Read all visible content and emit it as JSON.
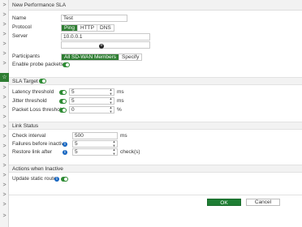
{
  "left_nav": {
    "chevrons": [
      ">",
      ">",
      ">",
      ">",
      ">",
      ">",
      ">",
      ">",
      ">",
      ">",
      ">",
      ">",
      ">",
      ">",
      ">",
      ">",
      ">",
      ">",
      ">",
      ">",
      ">"
    ],
    "active_icon": "star-icon"
  },
  "dialog": {
    "title": "New Performance SLA"
  },
  "form": {
    "name_label": "Name",
    "name_value": "Test",
    "protocol_label": "Protocol",
    "protocol_options": [
      "Ping",
      "HTTP",
      "DNS"
    ],
    "protocol_selected": "Ping",
    "server_label": "Server",
    "server_value": "10.0.0.1",
    "server_value_2": "",
    "add_server_icon": "plus-circle-icon",
    "participants_label": "Participants",
    "participants_options": [
      "All SD-WAN Members",
      "Specify"
    ],
    "participants_selected": "All SD-WAN Members",
    "probe_label": "Enable probe packets",
    "probe_enabled": true
  },
  "sla_target": {
    "header": "SLA Target",
    "enabled": true,
    "latency_label": "Latency threshold",
    "latency_value": "5",
    "latency_unit": "ms",
    "jitter_label": "Jitter threshold",
    "jitter_value": "5",
    "jitter_unit": "ms",
    "loss_label": "Packet Loss threshold",
    "loss_value": "0",
    "loss_unit": "%"
  },
  "link_status": {
    "header": "Link Status",
    "check_label": "Check interval",
    "check_value": "500",
    "check_unit": "ms",
    "failures_label": "Failures before inactive",
    "failures_value": "5",
    "restore_label": "Restore link after",
    "restore_value": "5",
    "restore_unit": "check(s)"
  },
  "actions": {
    "header": "Actions when Inactive",
    "update_label": "Update static route",
    "update_enabled": true
  },
  "buttons": {
    "ok": "OK",
    "cancel": "Cancel"
  },
  "colors": {
    "accent_green": "#2e7d32",
    "info_blue": "#1565c0"
  }
}
